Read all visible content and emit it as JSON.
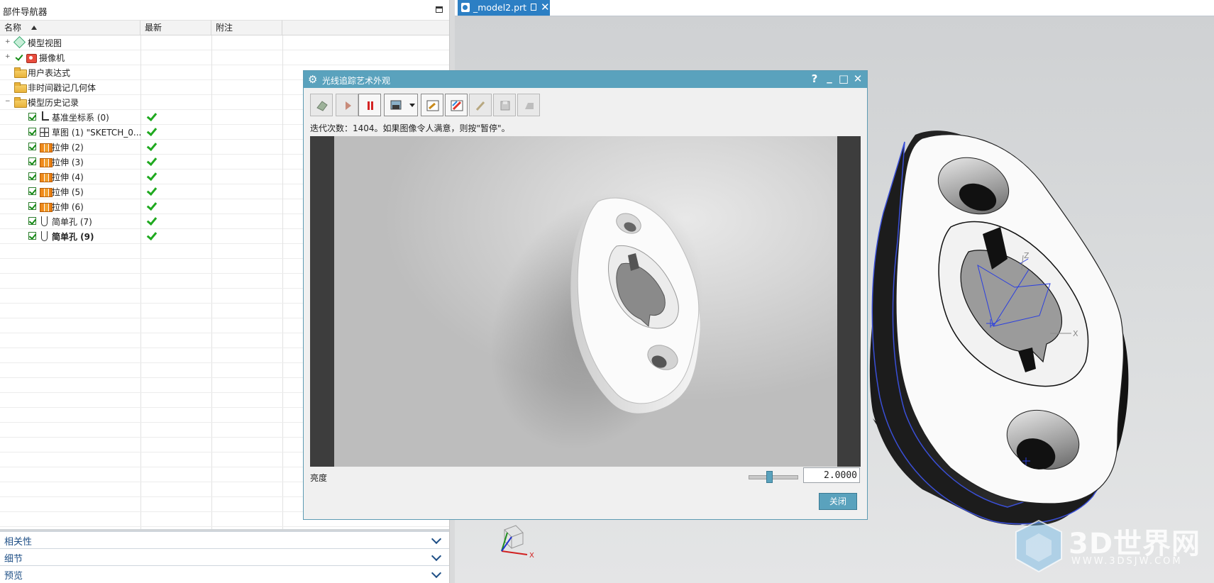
{
  "navigator": {
    "title": "部件导航器",
    "columns": {
      "name": "名称",
      "latest": "最新",
      "notes": "附注"
    },
    "rows": [
      {
        "label": "模型视图",
        "icon": "model-view-icon",
        "expander": "+"
      },
      {
        "label": "摄像机",
        "icon": "camera-icon",
        "expander": "+"
      },
      {
        "label": "用户表达式",
        "icon": "folder-icon"
      },
      {
        "label": "非时间戳记几何体",
        "icon": "folder-icon"
      },
      {
        "label": "模型历史记录",
        "icon": "folder-icon",
        "expander": "−"
      },
      {
        "label": "基准坐标系 (0)",
        "icon": "datum-csys-icon",
        "checked": true,
        "latest": true
      },
      {
        "label": "草图 (1) \"SKETCH_0...",
        "icon": "sketch-icon",
        "checked": true,
        "latest": true
      },
      {
        "label": "拉伸 (2)",
        "icon": "extrude-icon",
        "checked": true,
        "latest": true
      },
      {
        "label": "拉伸 (3)",
        "icon": "extrude-icon",
        "checked": true,
        "latest": true
      },
      {
        "label": "拉伸 (4)",
        "icon": "extrude-icon",
        "checked": true,
        "latest": true
      },
      {
        "label": "拉伸 (5)",
        "icon": "extrude-icon",
        "checked": true,
        "latest": true
      },
      {
        "label": "拉伸 (6)",
        "icon": "extrude-icon",
        "checked": true,
        "latest": true
      },
      {
        "label": "简单孔 (7)",
        "icon": "hole-icon",
        "checked": true,
        "latest": true
      },
      {
        "label": "简单孔 (9)",
        "icon": "hole-icon",
        "checked": true,
        "latest": true,
        "bold": true
      }
    ],
    "panels": [
      "相关性",
      "细节",
      "预览"
    ]
  },
  "tab": {
    "label": "_model2.prt",
    "close": "✕"
  },
  "dialog": {
    "title": "光线追踪艺术外观",
    "help": "?",
    "minimize": "_",
    "maximize": "□",
    "close_glyph": "✕",
    "iteration_text": "迭代次数：1404。如果图像令人满意，则按\"暂停\"。",
    "brightness_label": "亮度",
    "brightness_value": "2.0000",
    "brightness_slider_fraction": 0.4,
    "close_button": "关闭"
  },
  "watermark": {
    "title": "3D世界网",
    "url": "WWW.3DSJW.COM"
  },
  "triad": {
    "x": "X",
    "z": "Z"
  },
  "colors": {
    "accent": "#5aa2bd",
    "tab": "#2c7fc4",
    "check_green": "#1fa91f"
  }
}
